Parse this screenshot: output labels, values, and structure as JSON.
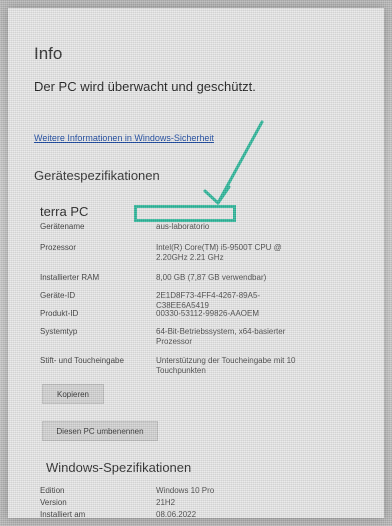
{
  "window": {
    "title": "Info"
  },
  "status": {
    "text": "Der PC wird überwacht und geschützt."
  },
  "link": {
    "text": "Weitere Informationen in Windows-Sicherheit"
  },
  "sections": {
    "device_specs": "Gerätespezifikationen",
    "windows_specs": "Windows-Spezifikationen"
  },
  "device": {
    "name": "terra PC"
  },
  "specs": [
    {
      "label": "Gerätename",
      "value": "aus-laboratorio"
    },
    {
      "label": "Prozessor",
      "value": "Intel(R) Core(TM) i5-9500T CPU @ 2.20GHz 2.21 GHz"
    },
    {
      "label": "Installierter RAM",
      "value": "8,00 GB (7,87 GB verwendbar)"
    },
    {
      "label": "Geräte-ID",
      "value": "2E1D8F73-4FF4-4267-89A5-C38EE6A5419"
    },
    {
      "label": "Produkt-ID",
      "value": "00330-53112-99826-AAOEM"
    },
    {
      "label": "Systemtyp",
      "value": "64-Bit-Betriebssystem, x64-basierter Prozessor"
    },
    {
      "label": "Stift- und Toucheingabe",
      "value": "Unterstützung der Toucheingabe mit 10 Touchpunkten"
    }
  ],
  "buttons": {
    "copy": "Kopieren",
    "rename": "Diesen PC umbenennen"
  },
  "windows_specs": [
    {
      "label": "Edition",
      "value": "Windows 10 Pro"
    },
    {
      "label": "Version",
      "value": "21H2"
    },
    {
      "label": "Installiert am",
      "value": "08.06.2022"
    }
  ],
  "colors": {
    "highlight": "#2fb79b",
    "link": "#1b4aa3"
  }
}
